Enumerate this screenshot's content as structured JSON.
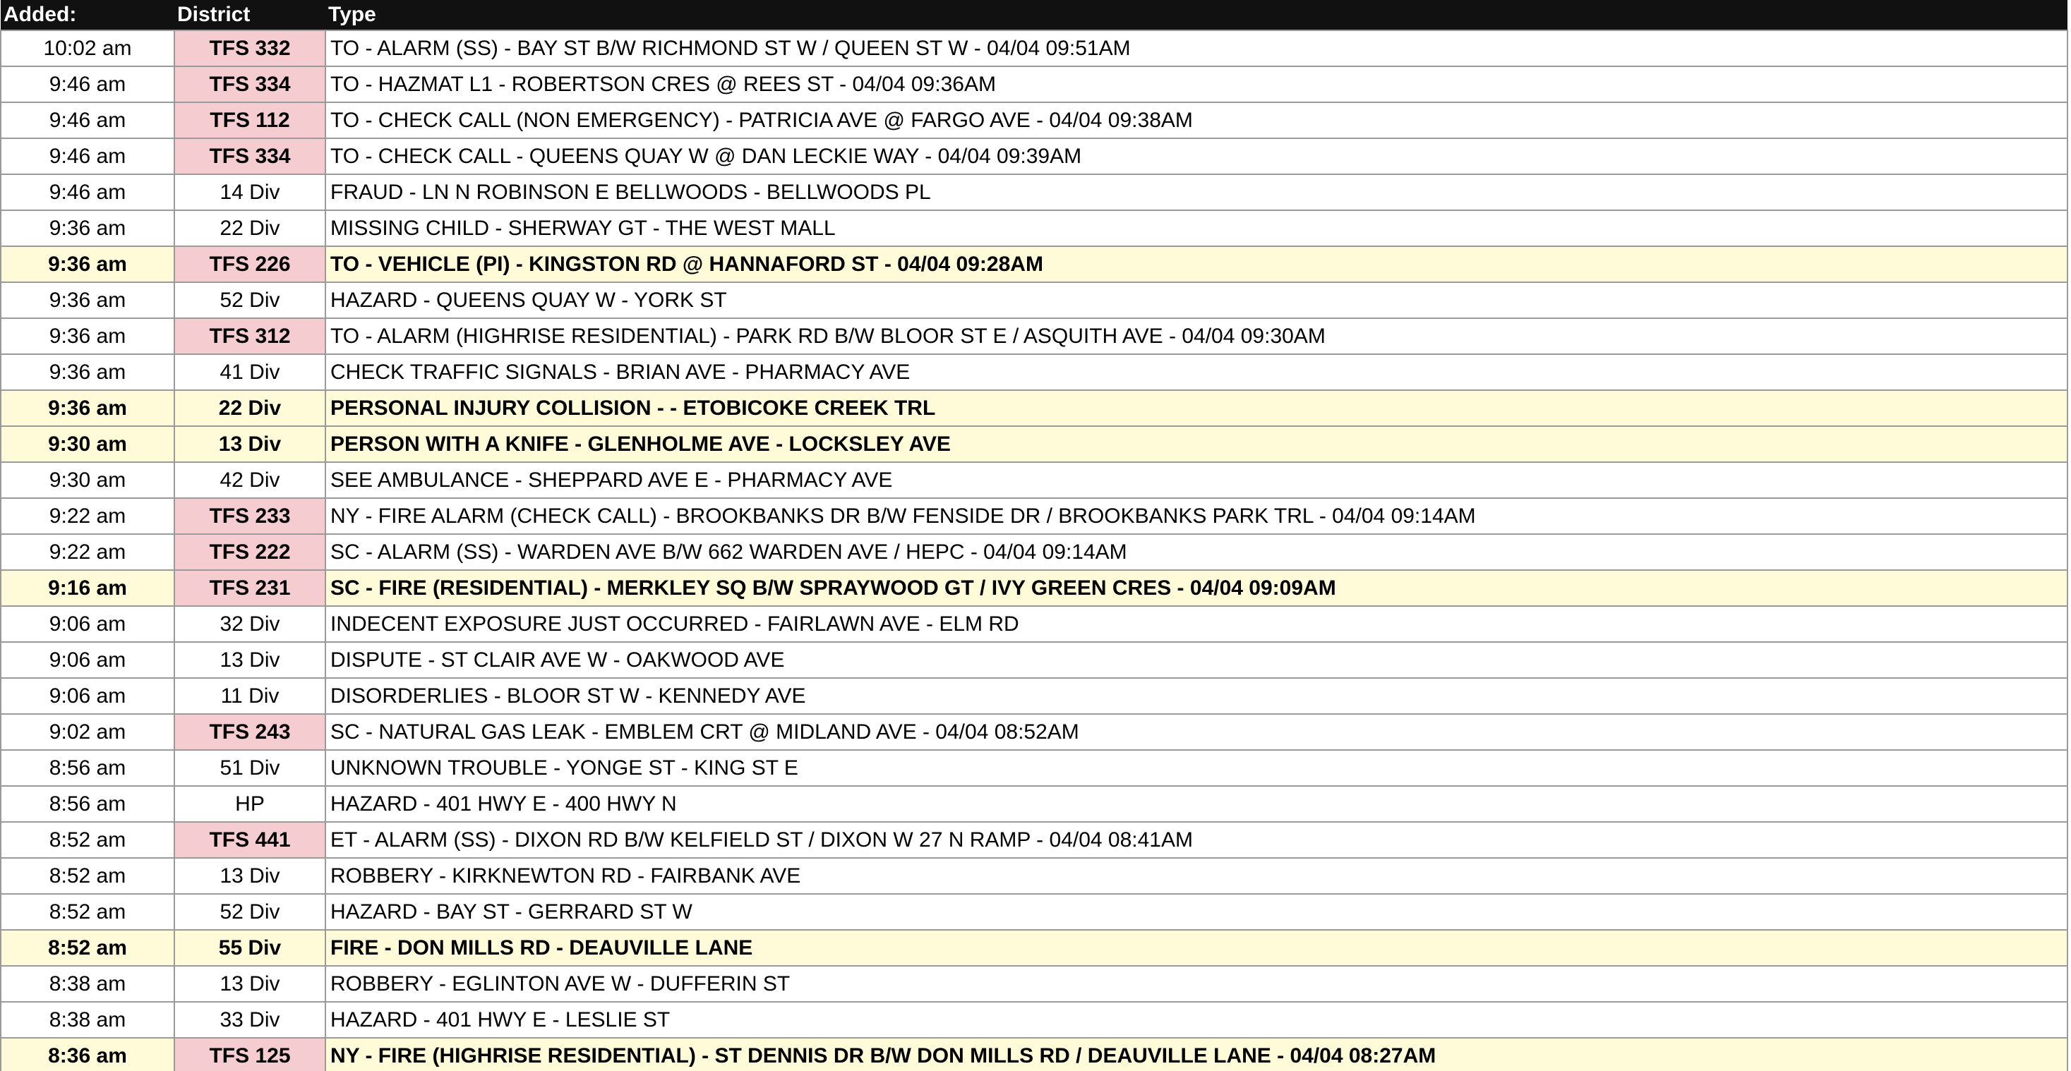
{
  "table": {
    "headers": {
      "added": "Added:",
      "district": "District",
      "type": "Type"
    },
    "rows": [
      {
        "added": "10:02 am",
        "district": "TFS 332",
        "type": "TO - ALARM (SS) - BAY ST B/W RICHMOND ST W / QUEEN ST W - 04/04 09:51AM",
        "tfs": true,
        "highlight": false
      },
      {
        "added": "9:46 am",
        "district": "TFS 334",
        "type": "TO - HAZMAT L1 - ROBERTSON CRES @ REES ST - 04/04 09:36AM",
        "tfs": true,
        "highlight": false
      },
      {
        "added": "9:46 am",
        "district": "TFS 112",
        "type": "TO - CHECK CALL (NON EMERGENCY) - PATRICIA AVE @ FARGO AVE - 04/04 09:38AM",
        "tfs": true,
        "highlight": false
      },
      {
        "added": "9:46 am",
        "district": "TFS 334",
        "type": "TO - CHECK CALL - QUEENS QUAY W @ DAN LECKIE WAY - 04/04 09:39AM",
        "tfs": true,
        "highlight": false
      },
      {
        "added": "9:46 am",
        "district": "14 Div",
        "type": "FRAUD - LN N ROBINSON E BELLWOODS - BELLWOODS PL",
        "tfs": false,
        "highlight": false
      },
      {
        "added": "9:36 am",
        "district": "22 Div",
        "type": "MISSING CHILD - SHERWAY GT - THE WEST MALL",
        "tfs": false,
        "highlight": false
      },
      {
        "added": "9:36 am",
        "district": "TFS 226",
        "type": "TO - VEHICLE (PI) - KINGSTON RD @ HANNAFORD ST - 04/04 09:28AM",
        "tfs": true,
        "highlight": true
      },
      {
        "added": "9:36 am",
        "district": "52 Div",
        "type": "HAZARD - QUEENS QUAY W - YORK ST",
        "tfs": false,
        "highlight": false
      },
      {
        "added": "9:36 am",
        "district": "TFS 312",
        "type": "TO - ALARM (HIGHRISE RESIDENTIAL) - PARK RD B/W BLOOR ST E / ASQUITH AVE - 04/04 09:30AM",
        "tfs": true,
        "highlight": false
      },
      {
        "added": "9:36 am",
        "district": "41 Div",
        "type": "CHECK TRAFFIC SIGNALS - BRIAN AVE - PHARMACY AVE",
        "tfs": false,
        "highlight": false
      },
      {
        "added": "9:36 am",
        "district": "22 Div",
        "type": "PERSONAL INJURY COLLISION - - ETOBICOKE CREEK TRL",
        "tfs": false,
        "highlight": true
      },
      {
        "added": "9:30 am",
        "district": "13 Div",
        "type": "PERSON WITH A KNIFE - GLENHOLME AVE - LOCKSLEY AVE",
        "tfs": false,
        "highlight": true
      },
      {
        "added": "9:30 am",
        "district": "42 Div",
        "type": "SEE AMBULANCE - SHEPPARD AVE E - PHARMACY AVE",
        "tfs": false,
        "highlight": false
      },
      {
        "added": "9:22 am",
        "district": "TFS 233",
        "type": "NY - FIRE ALARM (CHECK CALL) - BROOKBANKS DR B/W FENSIDE DR / BROOKBANKS PARK TRL - 04/04 09:14AM",
        "tfs": true,
        "highlight": false
      },
      {
        "added": "9:22 am",
        "district": "TFS 222",
        "type": "SC - ALARM (SS) - WARDEN AVE B/W 662 WARDEN AVE / HEPC - 04/04 09:14AM",
        "tfs": true,
        "highlight": false
      },
      {
        "added": "9:16 am",
        "district": "TFS 231",
        "type": "SC - FIRE (RESIDENTIAL) - MERKLEY SQ B/W SPRAYWOOD GT / IVY GREEN CRES - 04/04 09:09AM",
        "tfs": true,
        "highlight": true
      },
      {
        "added": "9:06 am",
        "district": "32 Div",
        "type": "INDECENT EXPOSURE JUST OCCURRED - FAIRLAWN AVE - ELM RD",
        "tfs": false,
        "highlight": false
      },
      {
        "added": "9:06 am",
        "district": "13 Div",
        "type": "DISPUTE - ST CLAIR AVE W - OAKWOOD AVE",
        "tfs": false,
        "highlight": false
      },
      {
        "added": "9:06 am",
        "district": "11 Div",
        "type": "DISORDERLIES - BLOOR ST W - KENNEDY AVE",
        "tfs": false,
        "highlight": false
      },
      {
        "added": "9:02 am",
        "district": "TFS 243",
        "type": "SC - NATURAL GAS LEAK - EMBLEM CRT @ MIDLAND AVE - 04/04 08:52AM",
        "tfs": true,
        "highlight": false
      },
      {
        "added": "8:56 am",
        "district": "51 Div",
        "type": "UNKNOWN TROUBLE - YONGE ST - KING ST E",
        "tfs": false,
        "highlight": false
      },
      {
        "added": "8:56 am",
        "district": "HP",
        "type": "HAZARD - 401 HWY E - 400 HWY N",
        "tfs": false,
        "highlight": false
      },
      {
        "added": "8:52 am",
        "district": "TFS 441",
        "type": "ET - ALARM (SS) - DIXON RD B/W KELFIELD ST / DIXON W 27 N RAMP - 04/04 08:41AM",
        "tfs": true,
        "highlight": false
      },
      {
        "added": "8:52 am",
        "district": "13 Div",
        "type": "ROBBERY - KIRKNEWTON RD - FAIRBANK AVE",
        "tfs": false,
        "highlight": false
      },
      {
        "added": "8:52 am",
        "district": "52 Div",
        "type": "HAZARD - BAY ST - GERRARD ST W",
        "tfs": false,
        "highlight": false
      },
      {
        "added": "8:52 am",
        "district": "55 Div",
        "type": "FIRE - DON MILLS RD - DEAUVILLE LANE",
        "tfs": false,
        "highlight": true
      },
      {
        "added": "8:38 am",
        "district": "13 Div",
        "type": "ROBBERY - EGLINTON AVE W - DUFFERIN ST",
        "tfs": false,
        "highlight": false
      },
      {
        "added": "8:38 am",
        "district": "33 Div",
        "type": "HAZARD - 401 HWY E - LESLIE ST",
        "tfs": false,
        "highlight": false
      },
      {
        "added": "8:36 am",
        "district": "TFS 125",
        "type": "NY - FIRE (HIGHRISE RESIDENTIAL) - ST DENNIS DR B/W DON MILLS RD / DEAUVILLE LANE - 04/04 08:27AM",
        "tfs": true,
        "highlight": true
      }
    ]
  },
  "colors": {
    "header_bg": "#111111",
    "tfs_bg": "#f5cdd0",
    "highlight_bg": "#fffbd9",
    "border": "#9a9a9a"
  }
}
